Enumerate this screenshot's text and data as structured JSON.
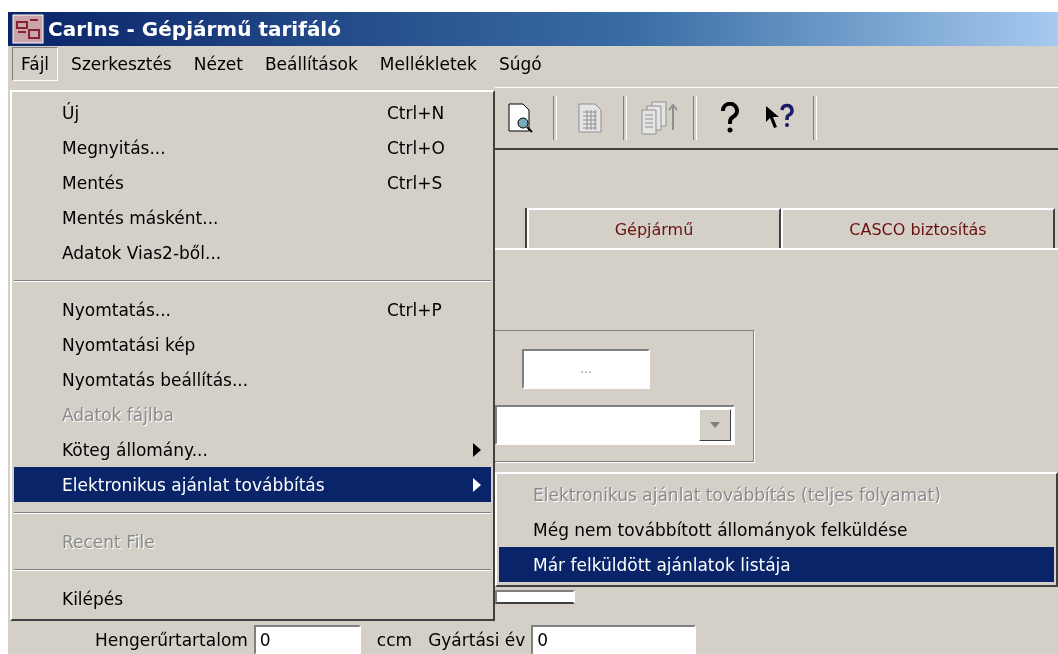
{
  "window": {
    "title": "CarIns - Gépjármű tarifáló"
  },
  "menubar": [
    {
      "label": "Fájl",
      "selected": true
    },
    {
      "label": "Szerkesztés",
      "selected": false
    },
    {
      "label": "Nézet",
      "selected": false
    },
    {
      "label": "Beállítások",
      "selected": false
    },
    {
      "label": "Mellékletek",
      "selected": false
    },
    {
      "label": "Súgó",
      "selected": false
    }
  ],
  "toolbar": [
    {
      "kind": "preview",
      "disabled": false
    },
    {
      "kind": "separator"
    },
    {
      "kind": "page",
      "disabled": true
    },
    {
      "kind": "separator"
    },
    {
      "kind": "copies",
      "disabled": true
    },
    {
      "kind": "separator"
    },
    {
      "kind": "help",
      "disabled": false
    },
    {
      "kind": "whatsthis",
      "disabled": false
    },
    {
      "kind": "separator"
    }
  ],
  "tabs": [
    {
      "label": "Gépjármű",
      "selected": false
    },
    {
      "label": "CASCO biztosítás",
      "selected": false
    }
  ],
  "form": {
    "code_field": {
      "value": "..."
    },
    "engine_label": "Hengerűrtartalom",
    "engine_value": "0",
    "engine_unit": "ccm",
    "year_label": "Gyártási év",
    "year_value": "0"
  },
  "file_menu": {
    "items": [
      {
        "kind": "item",
        "label": "Új",
        "shortcut": "Ctrl+N",
        "disabled": false,
        "selected": false,
        "submenu": false
      },
      {
        "kind": "item",
        "label": "Megnyitás...",
        "shortcut": "Ctrl+O",
        "disabled": false,
        "selected": false,
        "submenu": false
      },
      {
        "kind": "item",
        "label": "Mentés",
        "shortcut": "Ctrl+S",
        "disabled": false,
        "selected": false,
        "submenu": false
      },
      {
        "kind": "item",
        "label": "Mentés másként...",
        "disabled": false,
        "selected": false,
        "submenu": false
      },
      {
        "kind": "item",
        "label": "Adatok Vias2-ből...",
        "disabled": false,
        "selected": false,
        "submenu": false
      },
      {
        "kind": "separator"
      },
      {
        "kind": "item",
        "label": "Nyomtatás...",
        "shortcut": "Ctrl+P",
        "disabled": false,
        "selected": false,
        "submenu": false
      },
      {
        "kind": "item",
        "label": "Nyomtatási kép",
        "disabled": false,
        "selected": false,
        "submenu": false
      },
      {
        "kind": "item",
        "label": "Nyomtatás beállítás...",
        "disabled": false,
        "selected": false,
        "submenu": false
      },
      {
        "kind": "item",
        "label": "Adatok fájlba",
        "disabled": true,
        "selected": false,
        "submenu": false
      },
      {
        "kind": "item",
        "label": "Köteg állomány...",
        "disabled": false,
        "selected": false,
        "submenu": true
      },
      {
        "kind": "item",
        "label": "Elektronikus ajánlat továbbítás",
        "disabled": false,
        "selected": true,
        "submenu": true
      },
      {
        "kind": "separator"
      },
      {
        "kind": "item",
        "label": "Recent File",
        "disabled": true,
        "selected": false,
        "submenu": false
      },
      {
        "kind": "separator"
      },
      {
        "kind": "item",
        "label": "Kilépés",
        "disabled": false,
        "selected": false,
        "submenu": false
      }
    ]
  },
  "submenu": {
    "items": [
      {
        "label": "Elektronikus ajánlat továbbítás (teljes folyamat)",
        "disabled": true,
        "selected": false
      },
      {
        "label": "Még nem továbbított állományok felküldése",
        "disabled": false,
        "selected": false
      },
      {
        "label": "Már felküldött ajánlatok listája",
        "disabled": false,
        "selected": true
      }
    ]
  }
}
